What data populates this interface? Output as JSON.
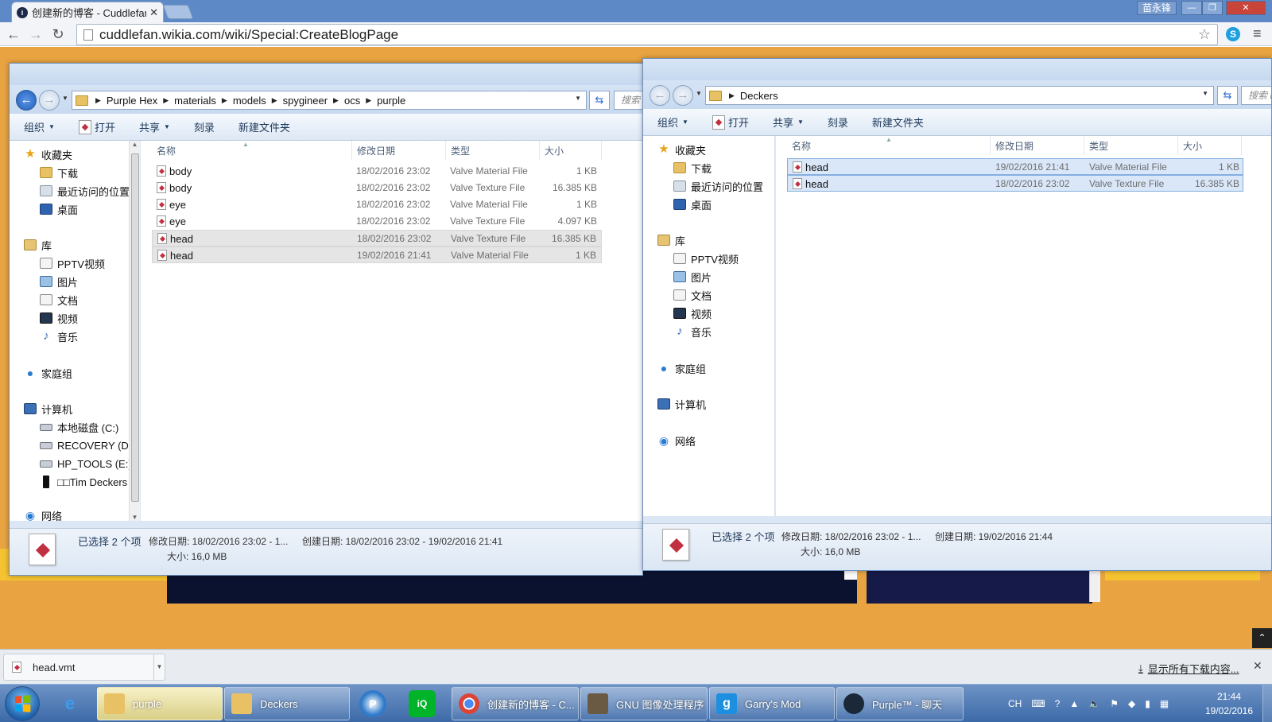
{
  "browser": {
    "tab_title": "创建新的博客 - Cuddlefan",
    "tab_close": "✕",
    "url": "cuddlefan.wikia.com/wiki/Special:CreateBlogPage",
    "window_user": "苗永锋"
  },
  "explorer_left": {
    "breadcrumbs": [
      "Purple Hex",
      "materials",
      "models",
      "spygineer",
      "ocs",
      "purple"
    ],
    "search_placeholder": "搜索 purple",
    "toolbar": {
      "organize": "组织",
      "open": "打开",
      "share": "共享",
      "burn": "刻录",
      "new_folder": "新建文件夹"
    },
    "columns": {
      "name": "名称",
      "date": "修改日期",
      "type": "类型",
      "size": "大小"
    },
    "files": [
      {
        "name": "body",
        "date": "18/02/2016 23:02",
        "type": "Valve Material File",
        "size": "1 KB",
        "state": "normal"
      },
      {
        "name": "body",
        "date": "18/02/2016 23:02",
        "type": "Valve Texture File",
        "size": "16.385 KB",
        "state": "normal"
      },
      {
        "name": "eye",
        "date": "18/02/2016 23:02",
        "type": "Valve Material File",
        "size": "1 KB",
        "state": "normal"
      },
      {
        "name": "eye",
        "date": "18/02/2016 23:02",
        "type": "Valve Texture File",
        "size": "4.097 KB",
        "state": "normal"
      },
      {
        "name": "head",
        "date": "18/02/2016 23:02",
        "type": "Valve Texture File",
        "size": "16.385 KB",
        "state": "hover"
      },
      {
        "name": "head",
        "date": "19/02/2016 21:41",
        "type": "Valve Material File",
        "size": "1 KB",
        "state": "hover"
      }
    ],
    "details": {
      "selected": "已选择 2 个项",
      "modified": "修改日期: 18/02/2016 23:02 - 1...",
      "created": "创建日期: 18/02/2016 23:02 - 19/02/2016 21:41",
      "size": "大小: 16,0 MB"
    }
  },
  "explorer_right": {
    "breadcrumbs": [
      "Deckers"
    ],
    "search_placeholder": "搜索 Deckers",
    "toolbar": {
      "organize": "组织",
      "open": "打开",
      "share": "共享",
      "burn": "刻录",
      "new_folder": "新建文件夹"
    },
    "columns": {
      "name": "名称",
      "date": "修改日期",
      "type": "类型",
      "size": "大小"
    },
    "files": [
      {
        "name": "head",
        "date": "19/02/2016 21:41",
        "type": "Valve Material File",
        "size": "1 KB",
        "state": "selected"
      },
      {
        "name": "head",
        "date": "18/02/2016 23:02",
        "type": "Valve Texture File",
        "size": "16.385 KB",
        "state": "selected"
      }
    ],
    "details": {
      "selected": "已选择 2 个项",
      "modified": "修改日期: 18/02/2016 23:02 - 1...",
      "created": "创建日期: 19/02/2016 21:44",
      "size": "大小: 16,0 MB"
    }
  },
  "nav": {
    "favorites": "收藏夹",
    "downloads": "下载",
    "recent": "最近访问的位置",
    "desktop": "桌面",
    "libraries": "库",
    "pptv": "PPTV视频",
    "pictures": "图片",
    "documents": "文档",
    "videos": "视频",
    "music": "音乐",
    "homegroup": "家庭组",
    "computer": "计算机",
    "drive_c": "本地磁盘 (C:)",
    "drive_d": "RECOVERY (D:)",
    "drive_e": "HP_TOOLS (E:)",
    "phone": "□□Tim Deckers",
    "network": "网络"
  },
  "download_bar": {
    "file": "head.vmt",
    "show_all": "显示所有下载内容...",
    "close": "✕"
  },
  "taskbar": {
    "tasks": [
      {
        "label": "purple",
        "active": true
      },
      {
        "label": "Deckers",
        "active": false
      },
      {
        "label": "创建新的博客 - C...",
        "active": false
      },
      {
        "label": "GNU 图像处理程序",
        "active": false
      },
      {
        "label": "Garry's Mod",
        "active": false
      },
      {
        "label": "Purple™ - 聊天",
        "active": false
      }
    ],
    "lang": "CH",
    "time": "21:44",
    "date": "19/02/2016"
  },
  "colors": {
    "accent": "#3c6aa8",
    "selection": "#d9e7f8",
    "selection_border": "#85aee0"
  }
}
